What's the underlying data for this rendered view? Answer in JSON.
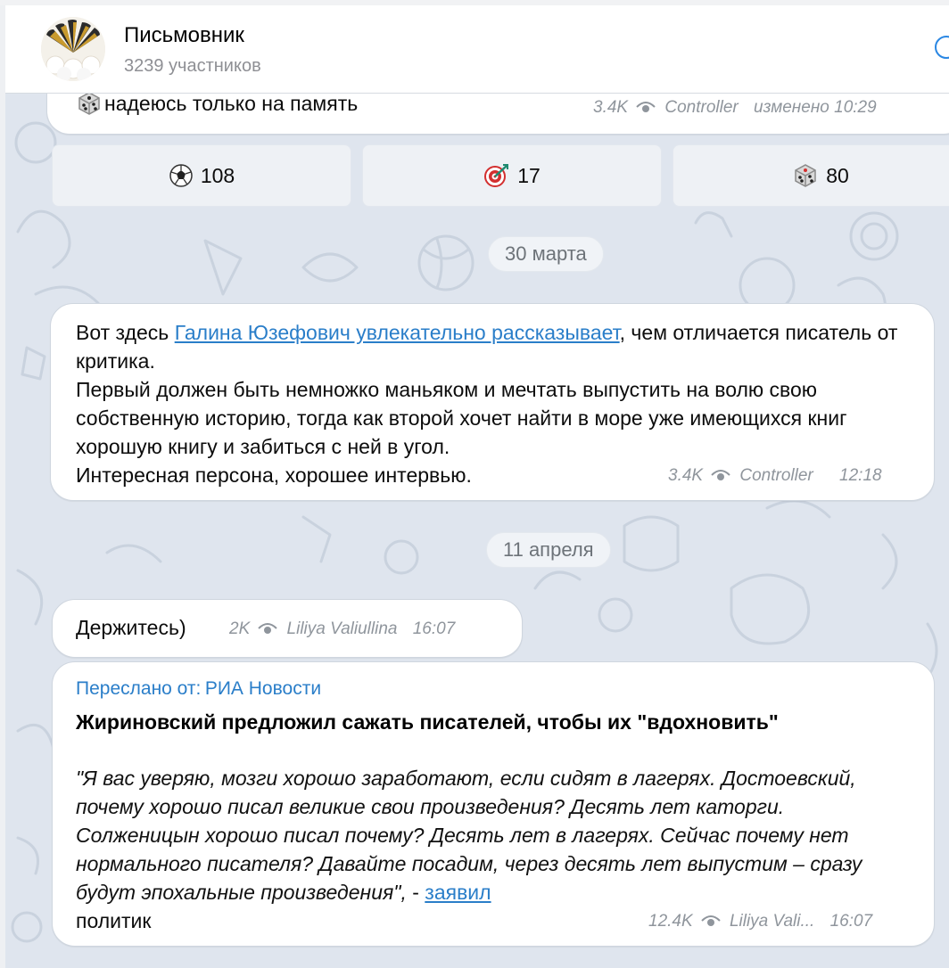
{
  "header": {
    "title": "Письмовник",
    "subtitle": "3239 участников"
  },
  "messages": {
    "m1": {
      "text": "надеюсь только на память",
      "views": "3.4K",
      "author": "Controller",
      "edited": "изменено",
      "time": "10:29"
    },
    "reactions": [
      {
        "icon": "soccer-ball-icon",
        "count": "108"
      },
      {
        "icon": "dart-icon",
        "count": "17"
      },
      {
        "icon": "dice-icon",
        "count": "80"
      }
    ],
    "date1": "30 марта",
    "m2": {
      "pre": "Вот здесь ",
      "link": "Галина Юзефович увлекательно рассказывает",
      "post": ", чем отличается писатель от критика.",
      "line2": "Первый должен быть немножко маньяком и мечтать выпустить на волю свою собственную историю, тогда как второй хочет найти в море уже имеющихся книг хорошую книгу и забиться с ней в угол.",
      "line3": "Интересная персона, хорошее интервью.",
      "views": "3.4K",
      "author": "Controller",
      "time": "12:18"
    },
    "date2": "11 апреля",
    "m3": {
      "text": "Держитесь)",
      "views": "2K",
      "author": "Liliya Valiullina",
      "time": "16:07"
    },
    "m4": {
      "forward_label": "Переслано от:",
      "forward_source": "РИА Новости",
      "headline": "Жириновский предложил сажать писателей, чтобы их \"вдохновить\"",
      "quote": "\"Я вас уверяю, мозги хорошо заработают, если сидят в лагерях. Достоевский, почему хорошо писал великие свои произведения? Десять лет каторги. Солженицын хорошо писал почему? Десять лет в лагерях. Сейчас почему нет нормального писателя? Давайте посадим, через десять лет выпустим – сразу будут эпохальные произведения\",",
      "dash": " - ",
      "link": "заявил",
      "tail": "политик",
      "views": "12.4K",
      "author": "Liliya Vali...",
      "time": "16:07"
    }
  }
}
